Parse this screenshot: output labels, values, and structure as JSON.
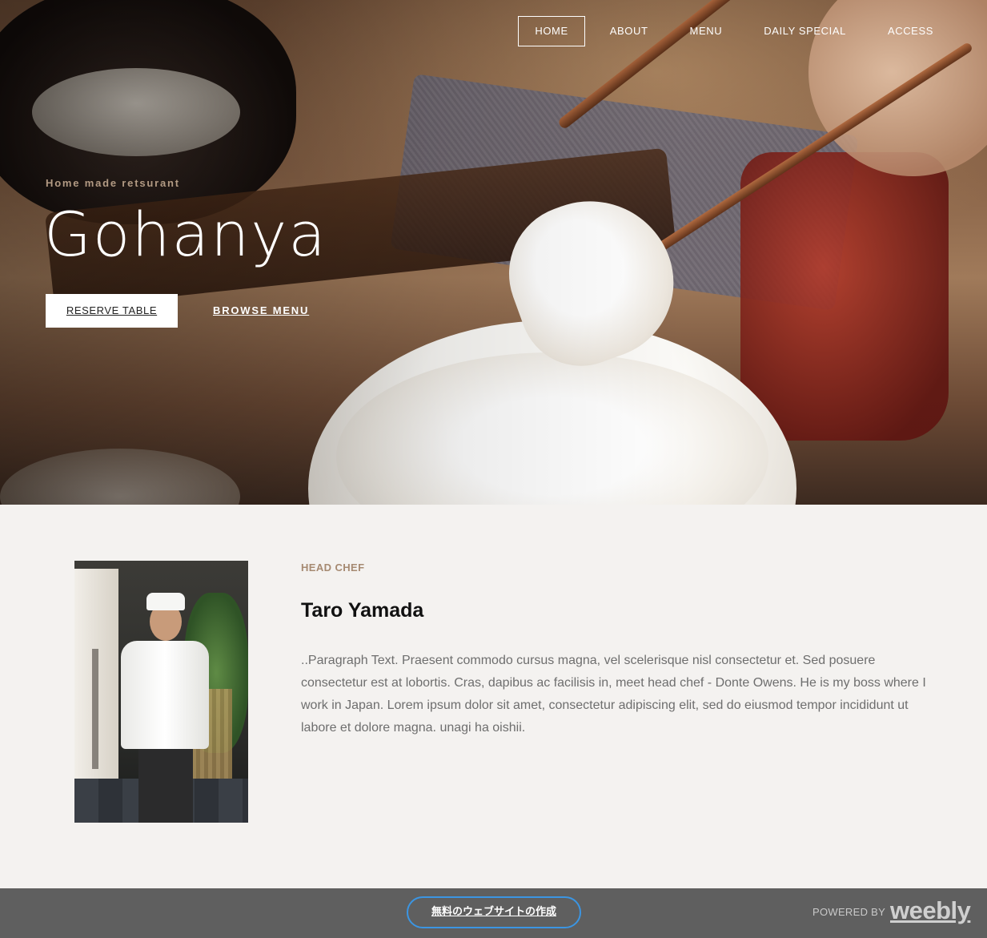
{
  "nav": {
    "items": [
      {
        "label": "HOME",
        "active": true
      },
      {
        "label": "ABOUT"
      },
      {
        "label": "MENU"
      },
      {
        "label": "DAILY SPECIAL"
      },
      {
        "label": "ACCESS"
      }
    ]
  },
  "hero": {
    "tagline": "Home made retsurant",
    "title": "Gohanya",
    "reserve_label": "RESERVE TABLE",
    "browse_label": "BROWSE MENU"
  },
  "chef": {
    "eyebrow": "HEAD CHEF",
    "name": "Taro Yamada",
    "bio": "..Paragraph Text. Praesent commodo cursus magna, vel scelerisque nisl consectetur et. Sed posuere consectetur est at lobortis. Cras, dapibus ac facilisis in, meet head chef - Donte Owens. He is my boss where I work in Japan. Lorem ipsum dolor sit amet, consectetur adipiscing elit, sed do eiusmod tempor incididunt ut labore et dolore magna. unagi ha oishii."
  },
  "footer": {
    "create_label": "無料のウェブサイトの作成",
    "powered_by": "POWERED BY",
    "brand": "weebly"
  },
  "colors": {
    "page_bg": "#f4f2f0",
    "accent_tan": "#a68a72",
    "footer_bg": "#5f5f5f",
    "create_border": "#3b95e2"
  }
}
